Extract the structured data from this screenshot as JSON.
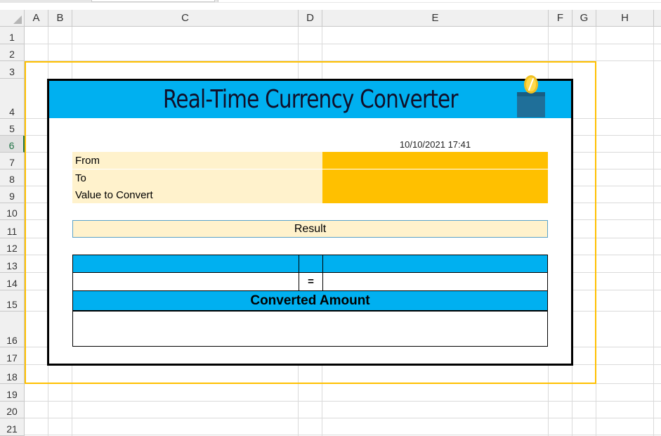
{
  "columns": [
    "A",
    "B",
    "C",
    "D",
    "E",
    "F",
    "G",
    "H"
  ],
  "rows": [
    "1",
    "2",
    "3",
    "4",
    "5",
    "6",
    "7",
    "8",
    "9",
    "10",
    "11",
    "12",
    "13",
    "14",
    "15",
    "16",
    "17",
    "18",
    "19",
    "20",
    "21"
  ],
  "selected_row": "6",
  "dashboard": {
    "title": "Real-Time Currency Converter",
    "icon": "coin-jar-icon",
    "datetime": "10/10/2021 17:41",
    "fields": [
      {
        "label": "From",
        "value": ""
      },
      {
        "label": "To",
        "value": ""
      },
      {
        "label": "Value to Convert",
        "value": ""
      }
    ],
    "result_label": "Result",
    "equals_sign": "=",
    "converted_label": "Converted Amount"
  },
  "colors": {
    "title_bar": "#00b0f0",
    "input_cells": "#ffc000",
    "label_cells": "#fff2cc",
    "frame": "#ffc000",
    "selection": "#217346"
  }
}
